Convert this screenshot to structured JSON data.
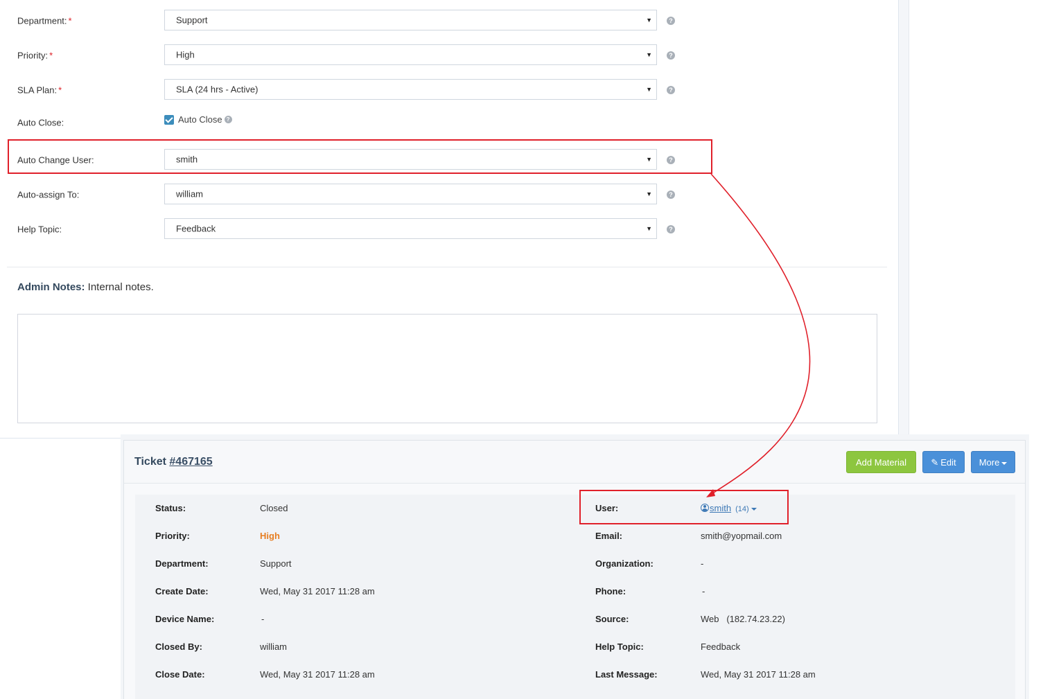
{
  "form": {
    "department": {
      "label": "Department:",
      "required": "*",
      "value": "Support"
    },
    "priority": {
      "label": "Priority:",
      "required": "*",
      "value": "High"
    },
    "sla_plan": {
      "label": "SLA Plan:",
      "required": "*",
      "value": "SLA (24 hrs - Active)"
    },
    "auto_close": {
      "label": "Auto Close:",
      "checkbox_label": "Auto Close",
      "checked": true
    },
    "auto_change_user": {
      "label": "Auto Change User:",
      "value": "smith"
    },
    "auto_assign_to": {
      "label": "Auto-assign To:",
      "value": "william"
    },
    "help_topic": {
      "label": "Help Topic:",
      "value": "Feedback"
    },
    "help_glyph": "?",
    "select_caret": "▼"
  },
  "admin_notes": {
    "heading": "Admin Notes:",
    "subtitle": "Internal notes.",
    "value": ""
  },
  "ticket": {
    "title_prefix": "Ticket",
    "number": "#467165",
    "buttons": {
      "add_material": "Add Material",
      "edit": "Edit",
      "edit_icon": "✎",
      "more": "More"
    },
    "left": [
      {
        "label": "Status:",
        "value": "Closed"
      },
      {
        "label": "Priority:",
        "value": "High"
      },
      {
        "label": "Department:",
        "value": "Support"
      },
      {
        "label": "Create Date:",
        "value": "Wed, May 31 2017 11:28 am"
      },
      {
        "label": "Device Name:",
        "value": "-"
      },
      {
        "label": "Closed By:",
        "value": "william"
      },
      {
        "label": "Close Date:",
        "value": "Wed, May 31 2017 11:28 am"
      }
    ],
    "right": [
      {
        "label": "User:",
        "value": "smith",
        "count": "(14)"
      },
      {
        "label": "Email:",
        "value": "smith@yopmail.com"
      },
      {
        "label": "Organization:",
        "value": "-"
      },
      {
        "label": "Phone:",
        "value": "-"
      },
      {
        "label": "Source:",
        "value": "Web   (182.74.23.22)"
      },
      {
        "label": "Help Topic:",
        "value": "Feedback"
      },
      {
        "label": "Last Message:",
        "value": "Wed, May 31 2017 11:28 am"
      }
    ]
  },
  "colors": {
    "highlight": "#e0202a",
    "add_material": "#8dc63f",
    "primary": "#4a90d9",
    "priority_high": "#e67e22",
    "link": "#3c78b5"
  },
  "icons": [
    "help-icon",
    "check-icon",
    "chevron-down-icon",
    "edit-icon",
    "user-icon",
    "arrow-annotation"
  ]
}
